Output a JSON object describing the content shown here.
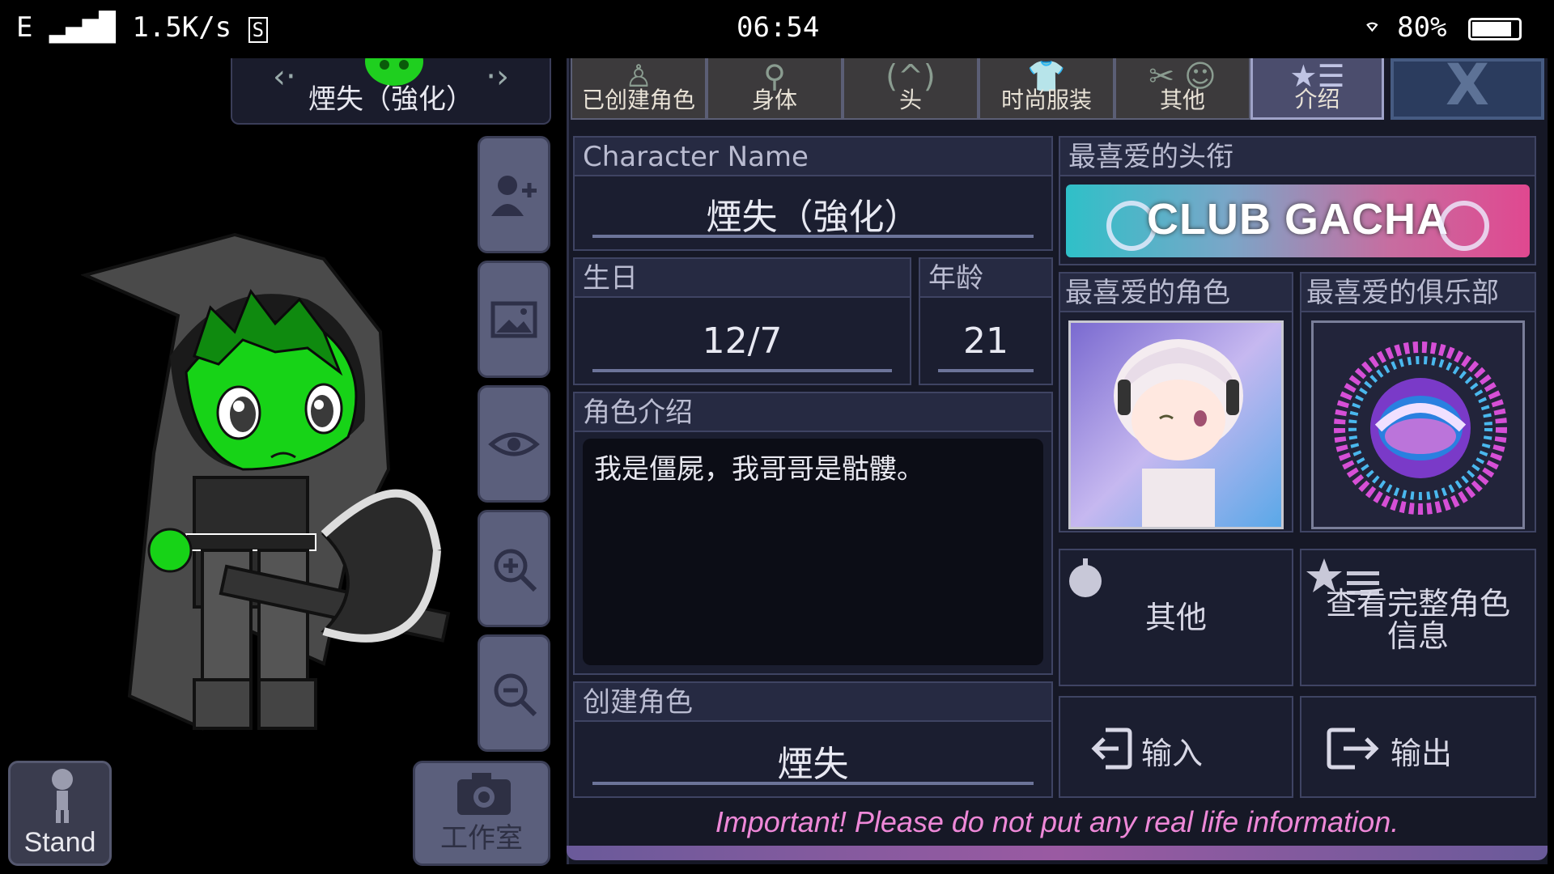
{
  "status_bar": {
    "signal": "E",
    "speed": "1.5K/s",
    "time": "06:54",
    "battery": "80%"
  },
  "character_selector": {
    "name": "煙失（強化）"
  },
  "side_buttons": [
    "add-character",
    "background",
    "view",
    "zoom-in",
    "zoom-out"
  ],
  "stand_button": {
    "label": "Stand"
  },
  "studio_button": {
    "label": "工作室"
  },
  "tabs": [
    {
      "label": "已创建角色"
    },
    {
      "label": "身体"
    },
    {
      "label": "头"
    },
    {
      "label": "时尚服装"
    },
    {
      "label": "其他"
    },
    {
      "label": "介绍"
    }
  ],
  "profile": {
    "name_label": "Character Name",
    "name_value": "煙失（強化）",
    "birthday_label": "生日",
    "birthday_value": "12/7",
    "age_label": "年龄",
    "age_value": "21",
    "intro_label": "角色介绍",
    "intro_value": "我是僵屍，我哥哥是骷髏。",
    "creator_label": "创建角色",
    "creator_value": "煙失"
  },
  "favorites": {
    "title_label": "最喜爱的头衔",
    "title_banner": "CLUB GACHA",
    "character_label": "最喜爱的角色",
    "club_label": "最喜爱的俱乐部"
  },
  "actions": {
    "other": "其他",
    "view_full": "查看完整角色信息",
    "import": "输入",
    "export": "输出"
  },
  "warning": "Important! Please do not put any real life information."
}
